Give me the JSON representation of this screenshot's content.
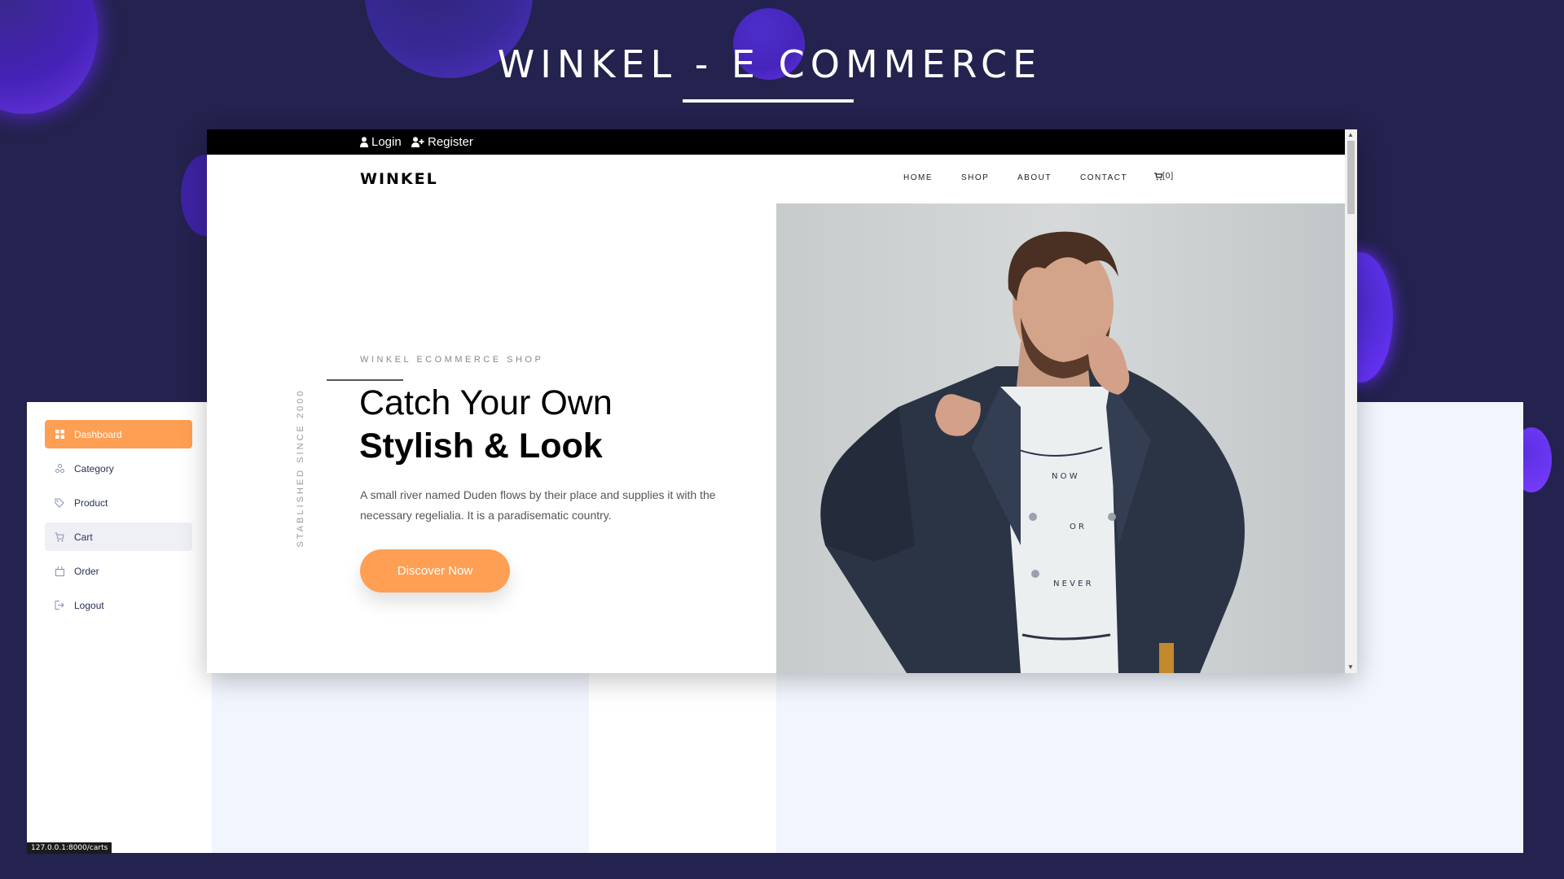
{
  "slide": {
    "title": "WINKEL - E COMMERCE"
  },
  "admin": {
    "menu": [
      {
        "label": "Dashboard",
        "icon": "dashboard-icon",
        "state": "active"
      },
      {
        "label": "Category",
        "icon": "category-icon",
        "state": "normal"
      },
      {
        "label": "Product",
        "icon": "tag-icon",
        "state": "normal"
      },
      {
        "label": "Cart",
        "icon": "cart-icon",
        "state": "hover"
      },
      {
        "label": "Order",
        "icon": "bag-icon",
        "state": "normal"
      },
      {
        "label": "Logout",
        "icon": "logout-icon",
        "state": "normal"
      }
    ],
    "status_url": "127.0.0.1:8000/carts"
  },
  "shop": {
    "topbar": {
      "login_label": "Login",
      "register_label": "Register"
    },
    "brand": "WINKEL",
    "nav": {
      "home": "HOME",
      "shop": "SHOP",
      "about": "ABOUT",
      "contact": "CONTACT",
      "cart_count": "[0]"
    },
    "hero": {
      "subtitle": "WINKEL ECOMMERCE SHOP",
      "established": "STABLISHED SINCE 2000",
      "title_line1": "Catch Your Own",
      "title_line2": "Stylish & Look",
      "text": "A small river named Duden flows by their place and supplies it with the necessary regelialia. It is a paradisematic country.",
      "button_label": "Discover Now",
      "shirt_words": [
        "N O W",
        "O R",
        "N E V E R"
      ]
    }
  },
  "colors": {
    "background": "#24224e",
    "accent": "#ff9f54",
    "panel_tint": "#f1f5fd"
  }
}
